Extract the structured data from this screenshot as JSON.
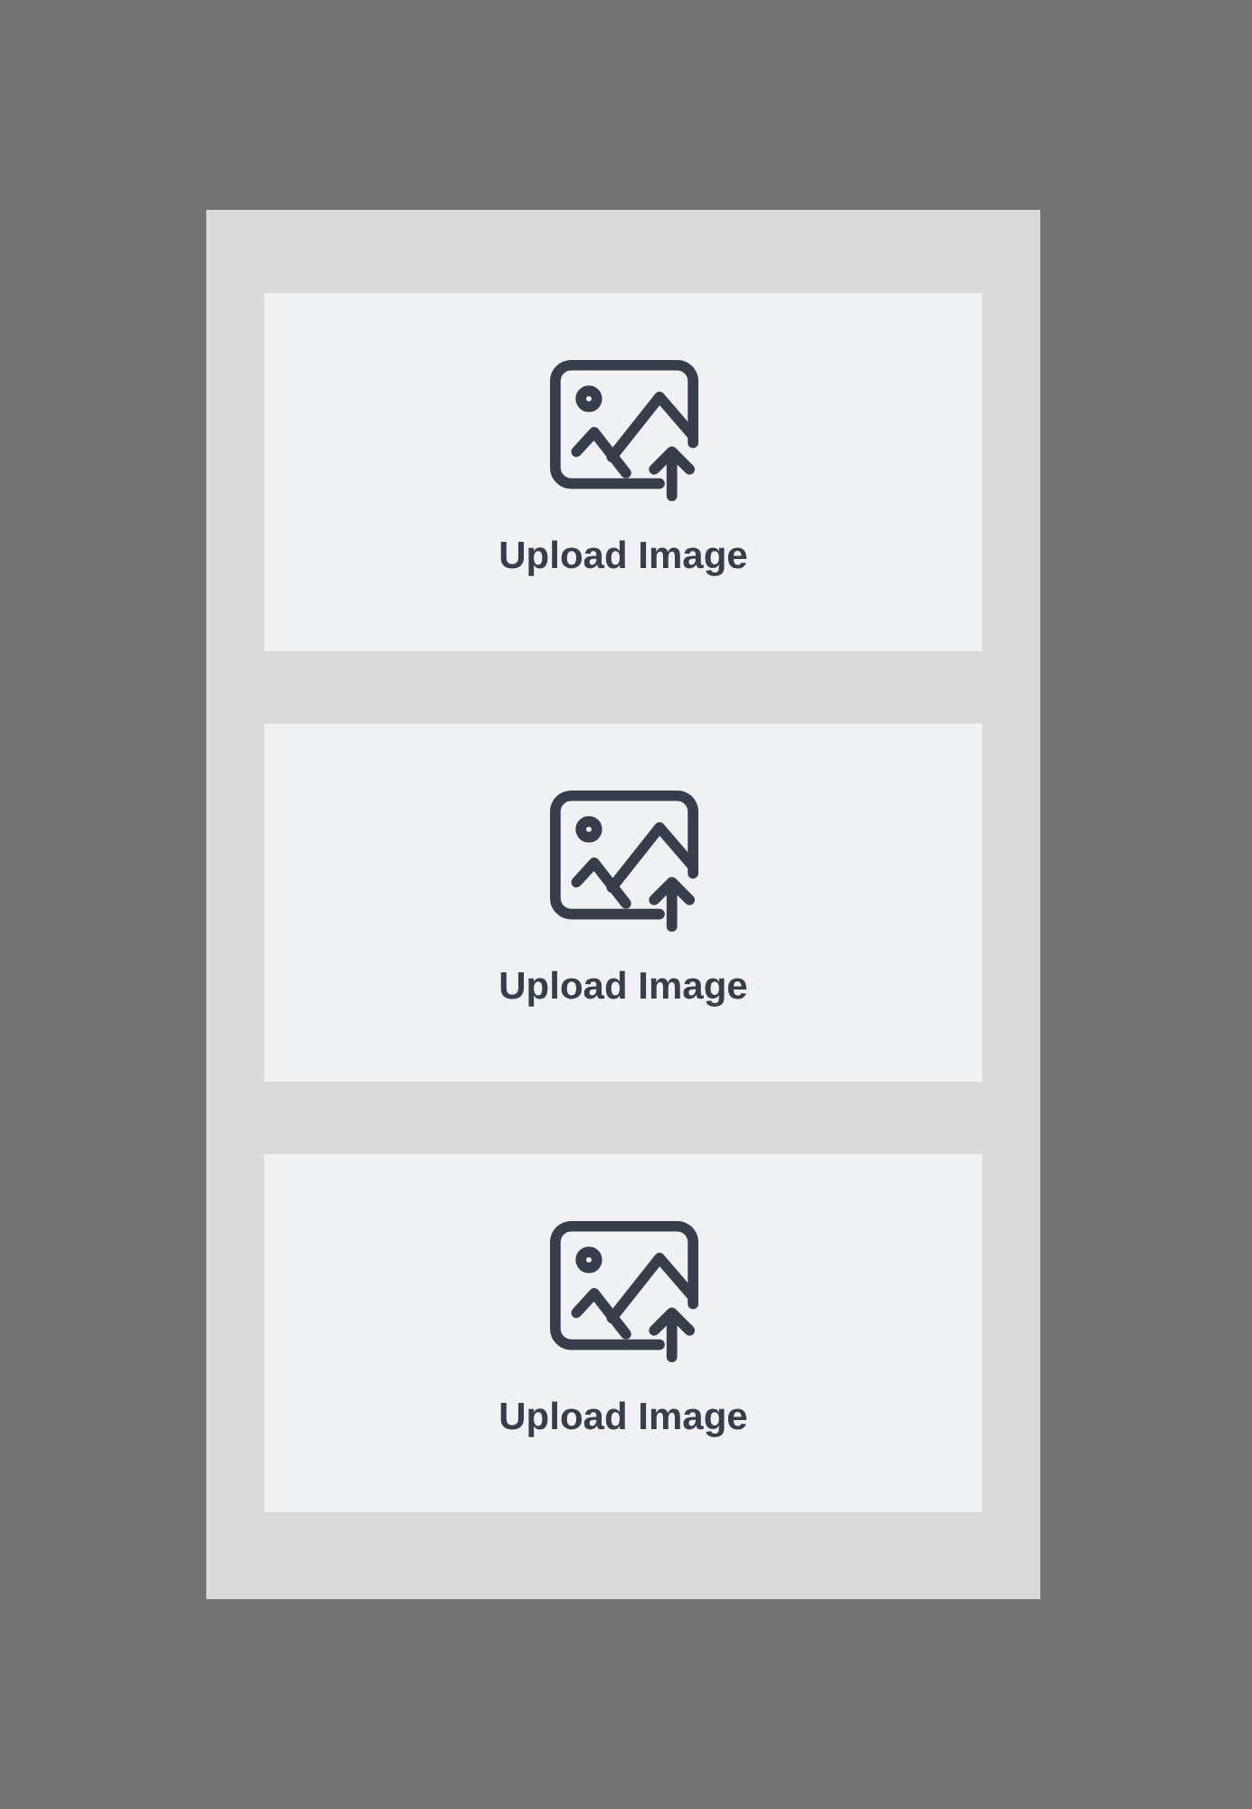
{
  "upload_slots": [
    {
      "label": "Upload Image"
    },
    {
      "label": "Upload Image"
    },
    {
      "label": "Upload Image"
    }
  ]
}
